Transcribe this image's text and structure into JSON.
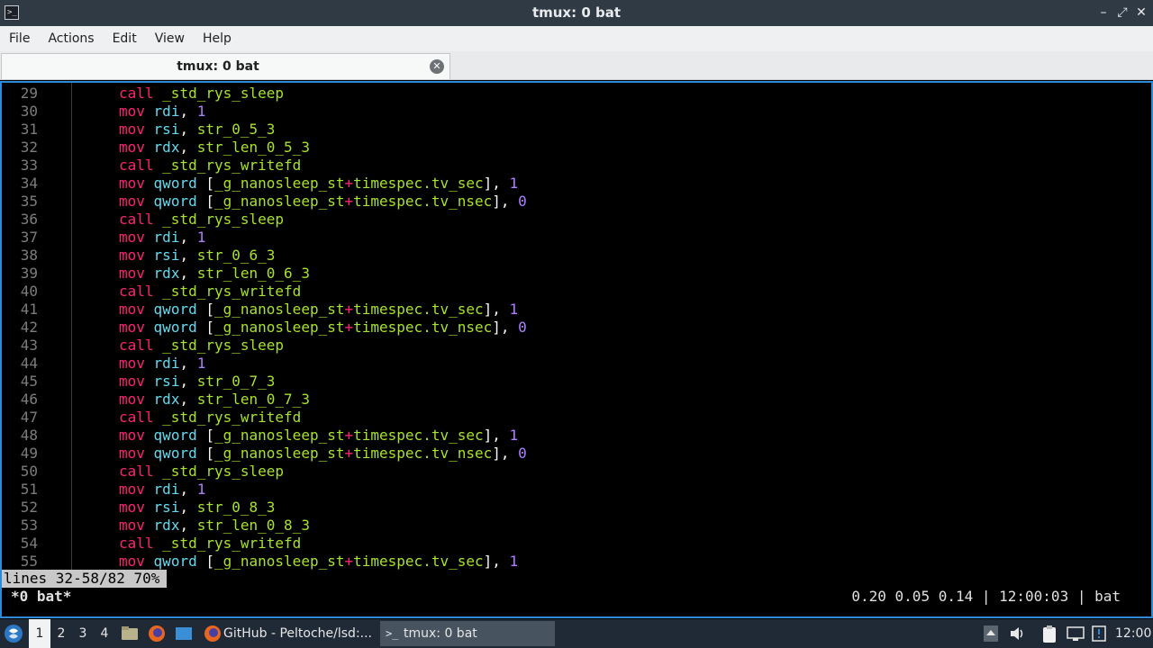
{
  "window": {
    "title": "tmux: 0 bat",
    "controls": {
      "minimize": "–",
      "maximize": "⤢",
      "close": "✕"
    }
  },
  "menu": [
    "File",
    "Actions",
    "Edit",
    "View",
    "Help"
  ],
  "tab": {
    "label": "tmux: 0 bat"
  },
  "code_lines": [
    {
      "n": "29",
      "tokens": [
        [
          "kw",
          "call"
        ],
        [
          "plain",
          " "
        ],
        [
          "fn",
          "_std_rys_sleep"
        ]
      ]
    },
    {
      "n": "30",
      "tokens": [
        [
          "kw",
          "mov"
        ],
        [
          "plain",
          " "
        ],
        [
          "reg",
          "rdi"
        ],
        [
          "plain",
          ", "
        ],
        [
          "num",
          "1"
        ]
      ]
    },
    {
      "n": "31",
      "tokens": [
        [
          "kw",
          "mov"
        ],
        [
          "plain",
          " "
        ],
        [
          "reg",
          "rsi"
        ],
        [
          "plain",
          ", "
        ],
        [
          "fn",
          "str_0_5_3"
        ]
      ]
    },
    {
      "n": "32",
      "tokens": [
        [
          "kw",
          "mov"
        ],
        [
          "plain",
          " "
        ],
        [
          "reg",
          "rdx"
        ],
        [
          "plain",
          ", "
        ],
        [
          "fn",
          "str_len_0_5_3"
        ]
      ]
    },
    {
      "n": "33",
      "tokens": [
        [
          "kw",
          "call"
        ],
        [
          "plain",
          " "
        ],
        [
          "fn",
          "_std_rys_writefd"
        ]
      ]
    },
    {
      "n": "34",
      "tokens": [
        [
          "kw",
          "mov"
        ],
        [
          "plain",
          " "
        ],
        [
          "reg",
          "qword"
        ],
        [
          "plain",
          " ["
        ],
        [
          "fn",
          "_g_nanosleep_st"
        ],
        [
          "op",
          "+"
        ],
        [
          "fn",
          "timespec.tv_sec"
        ],
        [
          "plain",
          "], "
        ],
        [
          "num",
          "1"
        ]
      ]
    },
    {
      "n": "35",
      "tokens": [
        [
          "kw",
          "mov"
        ],
        [
          "plain",
          " "
        ],
        [
          "reg",
          "qword"
        ],
        [
          "plain",
          " ["
        ],
        [
          "fn",
          "_g_nanosleep_st"
        ],
        [
          "op",
          "+"
        ],
        [
          "fn",
          "timespec.tv_nsec"
        ],
        [
          "plain",
          "], "
        ],
        [
          "num",
          "0"
        ]
      ]
    },
    {
      "n": "36",
      "tokens": [
        [
          "kw",
          "call"
        ],
        [
          "plain",
          " "
        ],
        [
          "fn",
          "_std_rys_sleep"
        ]
      ]
    },
    {
      "n": "37",
      "tokens": [
        [
          "kw",
          "mov"
        ],
        [
          "plain",
          " "
        ],
        [
          "reg",
          "rdi"
        ],
        [
          "plain",
          ", "
        ],
        [
          "num",
          "1"
        ]
      ]
    },
    {
      "n": "38",
      "tokens": [
        [
          "kw",
          "mov"
        ],
        [
          "plain",
          " "
        ],
        [
          "reg",
          "rsi"
        ],
        [
          "plain",
          ", "
        ],
        [
          "fn",
          "str_0_6_3"
        ]
      ]
    },
    {
      "n": "39",
      "tokens": [
        [
          "kw",
          "mov"
        ],
        [
          "plain",
          " "
        ],
        [
          "reg",
          "rdx"
        ],
        [
          "plain",
          ", "
        ],
        [
          "fn",
          "str_len_0_6_3"
        ]
      ]
    },
    {
      "n": "40",
      "tokens": [
        [
          "kw",
          "call"
        ],
        [
          "plain",
          " "
        ],
        [
          "fn",
          "_std_rys_writefd"
        ]
      ]
    },
    {
      "n": "41",
      "tokens": [
        [
          "kw",
          "mov"
        ],
        [
          "plain",
          " "
        ],
        [
          "reg",
          "qword"
        ],
        [
          "plain",
          " ["
        ],
        [
          "fn",
          "_g_nanosleep_st"
        ],
        [
          "op",
          "+"
        ],
        [
          "fn",
          "timespec.tv_sec"
        ],
        [
          "plain",
          "], "
        ],
        [
          "num",
          "1"
        ]
      ]
    },
    {
      "n": "42",
      "tokens": [
        [
          "kw",
          "mov"
        ],
        [
          "plain",
          " "
        ],
        [
          "reg",
          "qword"
        ],
        [
          "plain",
          " ["
        ],
        [
          "fn",
          "_g_nanosleep_st"
        ],
        [
          "op",
          "+"
        ],
        [
          "fn",
          "timespec.tv_nsec"
        ],
        [
          "plain",
          "], "
        ],
        [
          "num",
          "0"
        ]
      ]
    },
    {
      "n": "43",
      "tokens": [
        [
          "kw",
          "call"
        ],
        [
          "plain",
          " "
        ],
        [
          "fn",
          "_std_rys_sleep"
        ]
      ]
    },
    {
      "n": "44",
      "tokens": [
        [
          "kw",
          "mov"
        ],
        [
          "plain",
          " "
        ],
        [
          "reg",
          "rdi"
        ],
        [
          "plain",
          ", "
        ],
        [
          "num",
          "1"
        ]
      ]
    },
    {
      "n": "45",
      "tokens": [
        [
          "kw",
          "mov"
        ],
        [
          "plain",
          " "
        ],
        [
          "reg",
          "rsi"
        ],
        [
          "plain",
          ", "
        ],
        [
          "fn",
          "str_0_7_3"
        ]
      ]
    },
    {
      "n": "46",
      "tokens": [
        [
          "kw",
          "mov"
        ],
        [
          "plain",
          " "
        ],
        [
          "reg",
          "rdx"
        ],
        [
          "plain",
          ", "
        ],
        [
          "fn",
          "str_len_0_7_3"
        ]
      ]
    },
    {
      "n": "47",
      "tokens": [
        [
          "kw",
          "call"
        ],
        [
          "plain",
          " "
        ],
        [
          "fn",
          "_std_rys_writefd"
        ]
      ]
    },
    {
      "n": "48",
      "tokens": [
        [
          "kw",
          "mov"
        ],
        [
          "plain",
          " "
        ],
        [
          "reg",
          "qword"
        ],
        [
          "plain",
          " ["
        ],
        [
          "fn",
          "_g_nanosleep_st"
        ],
        [
          "op",
          "+"
        ],
        [
          "fn",
          "timespec.tv_sec"
        ],
        [
          "plain",
          "], "
        ],
        [
          "num",
          "1"
        ]
      ]
    },
    {
      "n": "49",
      "tokens": [
        [
          "kw",
          "mov"
        ],
        [
          "plain",
          " "
        ],
        [
          "reg",
          "qword"
        ],
        [
          "plain",
          " ["
        ],
        [
          "fn",
          "_g_nanosleep_st"
        ],
        [
          "op",
          "+"
        ],
        [
          "fn",
          "timespec.tv_nsec"
        ],
        [
          "plain",
          "], "
        ],
        [
          "num",
          "0"
        ]
      ]
    },
    {
      "n": "50",
      "tokens": [
        [
          "kw",
          "call"
        ],
        [
          "plain",
          " "
        ],
        [
          "fn",
          "_std_rys_sleep"
        ]
      ]
    },
    {
      "n": "51",
      "tokens": [
        [
          "kw",
          "mov"
        ],
        [
          "plain",
          " "
        ],
        [
          "reg",
          "rdi"
        ],
        [
          "plain",
          ", "
        ],
        [
          "num",
          "1"
        ]
      ]
    },
    {
      "n": "52",
      "tokens": [
        [
          "kw",
          "mov"
        ],
        [
          "plain",
          " "
        ],
        [
          "reg",
          "rsi"
        ],
        [
          "plain",
          ", "
        ],
        [
          "fn",
          "str_0_8_3"
        ]
      ]
    },
    {
      "n": "53",
      "tokens": [
        [
          "kw",
          "mov"
        ],
        [
          "plain",
          " "
        ],
        [
          "reg",
          "rdx"
        ],
        [
          "plain",
          ", "
        ],
        [
          "fn",
          "str_len_0_8_3"
        ]
      ]
    },
    {
      "n": "54",
      "tokens": [
        [
          "kw",
          "call"
        ],
        [
          "plain",
          " "
        ],
        [
          "fn",
          "_std_rys_writefd"
        ]
      ]
    },
    {
      "n": "55",
      "tokens": [
        [
          "kw",
          "mov"
        ],
        [
          "plain",
          " "
        ],
        [
          "reg",
          "qword"
        ],
        [
          "plain",
          " ["
        ],
        [
          "fn",
          "_g_nanosleep_st"
        ],
        [
          "op",
          "+"
        ],
        [
          "fn",
          "timespec.tv_sec"
        ],
        [
          "plain",
          "], "
        ],
        [
          "num",
          "1"
        ]
      ]
    }
  ],
  "pager_status": "lines 32-58/82 70%",
  "tmux": {
    "window_label": "*0 bat*",
    "right_status": "0.20 0.05 0.14 | 12:00:03 | bat"
  },
  "taskbar": {
    "workspaces": [
      "1",
      "2",
      "3",
      "4"
    ],
    "active_workspace": "1",
    "tasks": [
      {
        "label": "GitHub - Peltoche/lsd:...",
        "icon": "firefox-icon",
        "active": false
      },
      {
        "label": "tmux: 0 bat",
        "icon": "terminal-icon",
        "active": true
      }
    ],
    "clock": "12:00"
  },
  "colors": {
    "keyword": "#f92672",
    "register": "#66d9ef",
    "identifier": "#a6e22e",
    "number": "#ae81ff",
    "accent_border": "#2d8ad8"
  }
}
